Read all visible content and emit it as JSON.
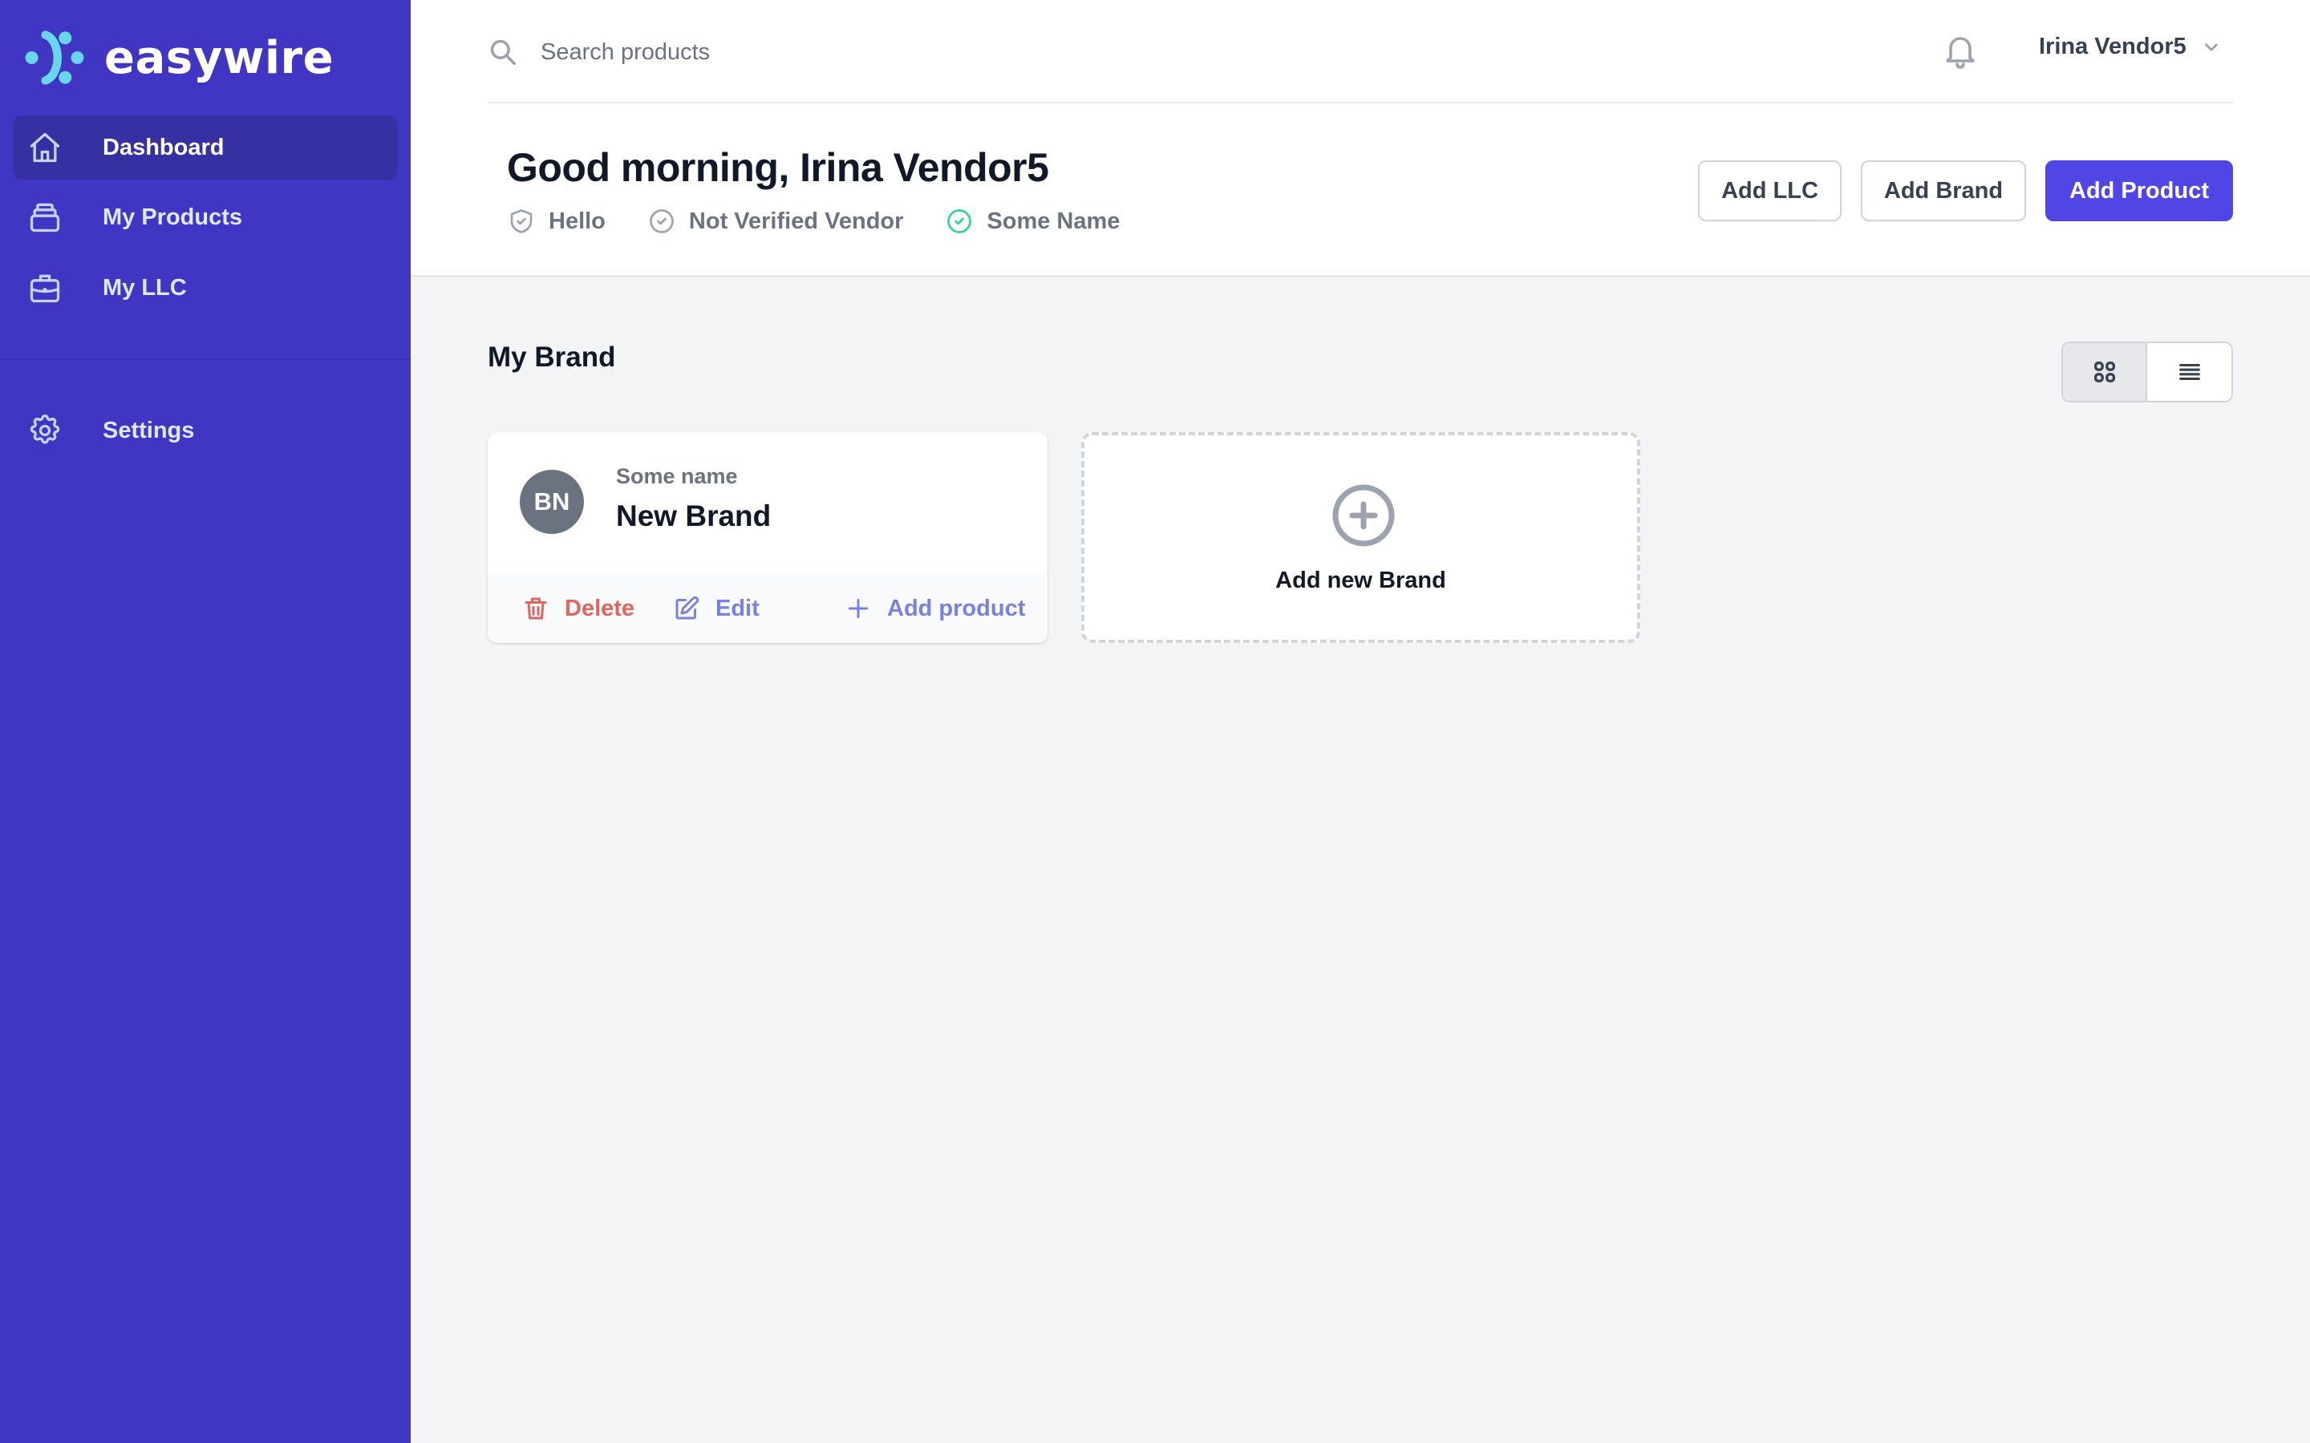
{
  "app": {
    "logo_text": "easywire",
    "brand_color": "#4036c3",
    "accent_color": "#4f46e5",
    "logo_color": "#6ad6ee"
  },
  "sidebar": {
    "items": [
      {
        "label": "Dashboard",
        "icon": "home-icon",
        "active": true
      },
      {
        "label": "My Products",
        "icon": "archive-icon",
        "active": false
      },
      {
        "label": "My LLC",
        "icon": "briefcase-icon",
        "active": false
      }
    ],
    "secondary": [
      {
        "label": "Settings",
        "icon": "gear-icon"
      }
    ]
  },
  "topbar": {
    "search_placeholder": "Search products",
    "search_value": "",
    "user_name": "Irina Vendor5",
    "notifications_icon": "bell-icon"
  },
  "header": {
    "greeting": "Good morning, Irina Vendor5",
    "badges": [
      {
        "label": "Hello",
        "icon": "shield-check-icon",
        "color": "#9ca3af"
      },
      {
        "label": "Not Verified Vendor",
        "icon": "check-circle-icon",
        "color": "#9ca3af"
      },
      {
        "label": "Some Name",
        "icon": "check-circle-icon",
        "color": "#34d399"
      }
    ],
    "buttons": {
      "add_llc": "Add LLC",
      "add_brand": "Add Brand",
      "add_product": "Add Product"
    }
  },
  "main": {
    "section_title": "My Brand",
    "view_mode": "grid",
    "brands": [
      {
        "initials": "BN",
        "subtitle": "Some name",
        "name": "New Brand",
        "actions": {
          "delete": "Delete",
          "edit": "Edit",
          "add_product": "Add product"
        }
      }
    ],
    "add_brand_card_label": "Add new Brand"
  }
}
